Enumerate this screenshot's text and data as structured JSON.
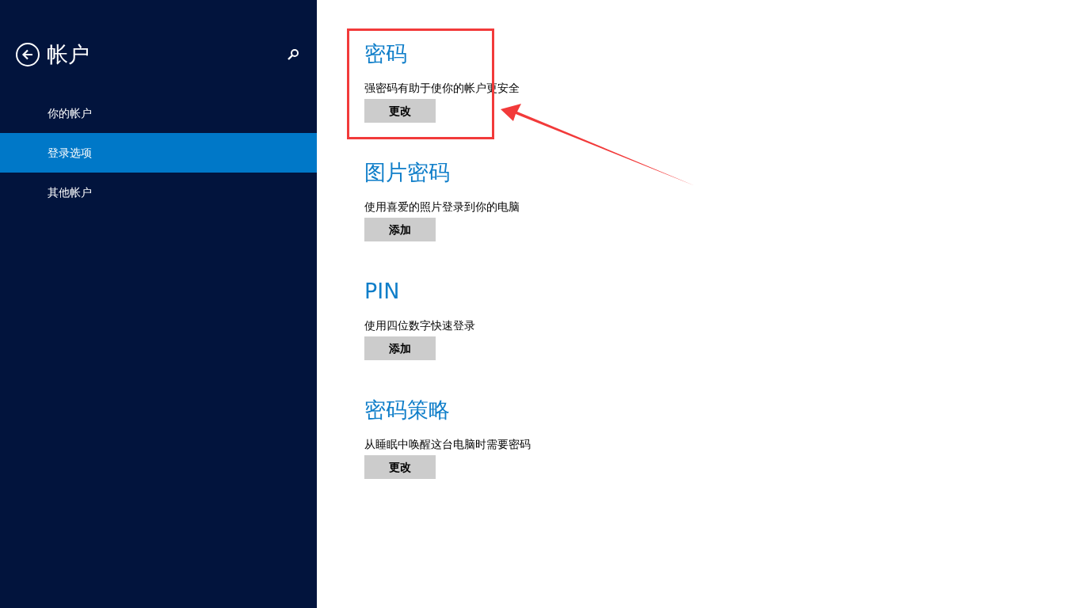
{
  "sidebar": {
    "title": "帐户",
    "items": [
      {
        "label": "你的帐户",
        "selected": false
      },
      {
        "label": "登录选项",
        "selected": true
      },
      {
        "label": "其他帐户",
        "selected": false
      }
    ]
  },
  "sections": [
    {
      "title": "密码",
      "description": "强密码有助于使你的帐户更安全",
      "button": "更改"
    },
    {
      "title": "图片密码",
      "description": "使用喜爱的照片登录到你的电脑",
      "button": "添加"
    },
    {
      "title": "PIN",
      "description": "使用四位数字快速登录",
      "button": "添加"
    },
    {
      "title": "密码策略",
      "description": "从睡眠中唤醒这台电脑时需要密码",
      "button": "更改"
    }
  ]
}
